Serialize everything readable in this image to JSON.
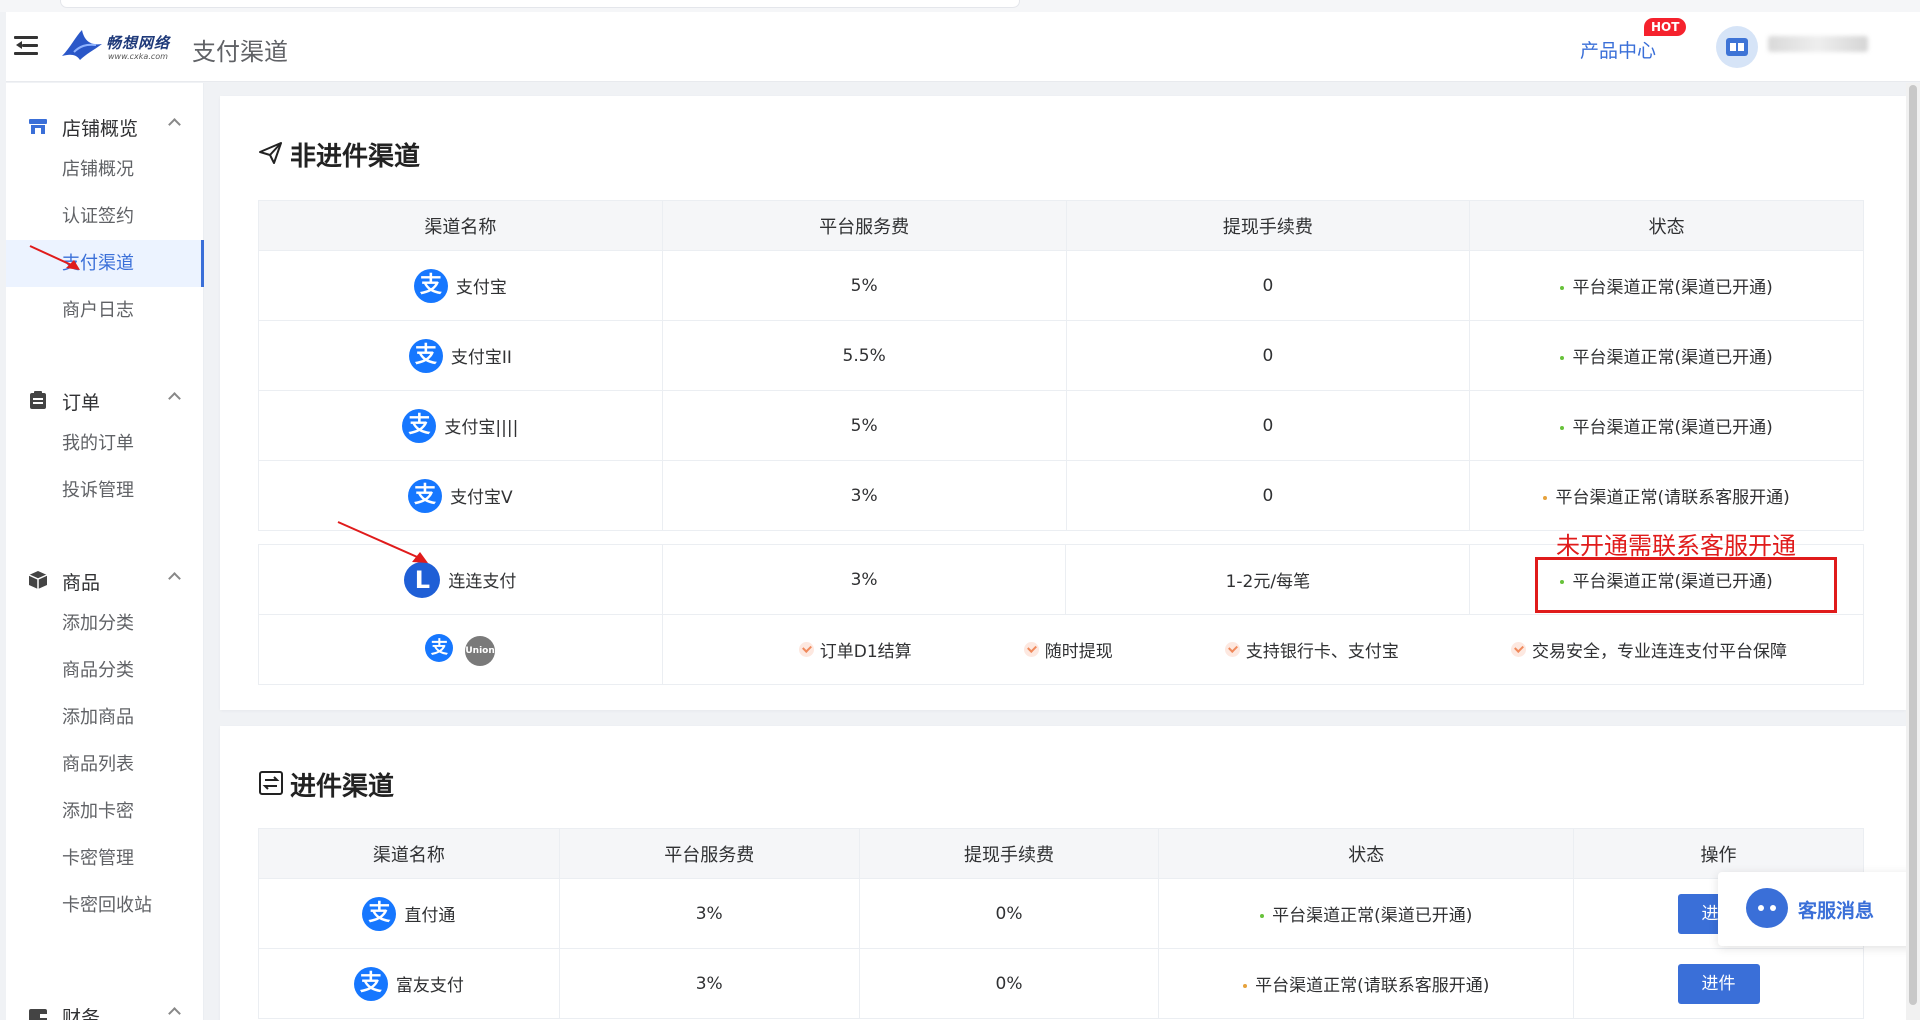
{
  "header": {
    "logo_text": "畅想网络",
    "logo_sub": "www.cxka.com",
    "page_title": "支付渠道",
    "product_center": "产品中心",
    "hot_badge": "HOT"
  },
  "sidebar": {
    "groups": [
      {
        "label": "店铺概览",
        "icon": "store-icon",
        "items": [
          "店铺概况",
          "认证签约",
          "支付渠道",
          "商户日志"
        ],
        "active": "支付渠道"
      },
      {
        "label": "订单",
        "icon": "clipboard-icon",
        "items": [
          "我的订单",
          "投诉管理"
        ]
      },
      {
        "label": "商品",
        "icon": "box-icon",
        "items": [
          "添加分类",
          "商品分类",
          "添加商品",
          "商品列表",
          "添加卡密",
          "卡密管理",
          "卡密回收站"
        ]
      },
      {
        "label": "财务",
        "icon": "wallet-icon",
        "items": []
      }
    ]
  },
  "section1": {
    "title": "非进件渠道",
    "columns": [
      "渠道名称",
      "平台服务费",
      "提现手续费",
      "状态"
    ],
    "rows": [
      {
        "icon": "alipay-icon",
        "name": "支付宝",
        "fee": "5%",
        "withdraw": "0",
        "status": "平台渠道正常(渠道已开通)",
        "status_color": "#67c23a"
      },
      {
        "icon": "alipay-icon",
        "name": "支付宝II",
        "fee": "5.5%",
        "withdraw": "0",
        "status": "平台渠道正常(渠道已开通)",
        "status_color": "#67c23a"
      },
      {
        "icon": "alipay-icon",
        "name": "支付宝||||",
        "fee": "5%",
        "withdraw": "0",
        "status": "平台渠道正常(渠道已开通)",
        "status_color": "#67c23a"
      },
      {
        "icon": "alipay-icon",
        "name": "支付宝V",
        "fee": "3%",
        "withdraw": "0",
        "status": "平台渠道正常(请联系客服开通)",
        "status_color": "#e6a23c"
      }
    ],
    "lianlian": {
      "name": "连连支付",
      "fee": "3%",
      "withdraw": "1-2元/每笔",
      "status": "平台渠道正常(渠道已开通)",
      "features": [
        "订单D1结算",
        "随时提现",
        "支持银行卡、支付宝",
        "交易安全，专业连连支付平台保障"
      ],
      "unionpay_label": "UnionPay"
    },
    "annotation": "未开通需联系客服开通"
  },
  "section2": {
    "title": "进件渠道",
    "columns": [
      "渠道名称",
      "平台服务费",
      "提现手续费",
      "状态",
      "操作"
    ],
    "rows": [
      {
        "name": "直付通",
        "fee": "3%",
        "withdraw": "0%",
        "status": "平台渠道正常(渠道已开通)",
        "status_color": "#67c23a",
        "action": "进件"
      },
      {
        "name": "富友支付",
        "fee": "3%",
        "withdraw": "0%",
        "status": "平台渠道正常(请联系客服开通)",
        "status_color": "#e6a23c",
        "action": "进件"
      }
    ]
  },
  "float_cs": {
    "label": "客服消息"
  }
}
